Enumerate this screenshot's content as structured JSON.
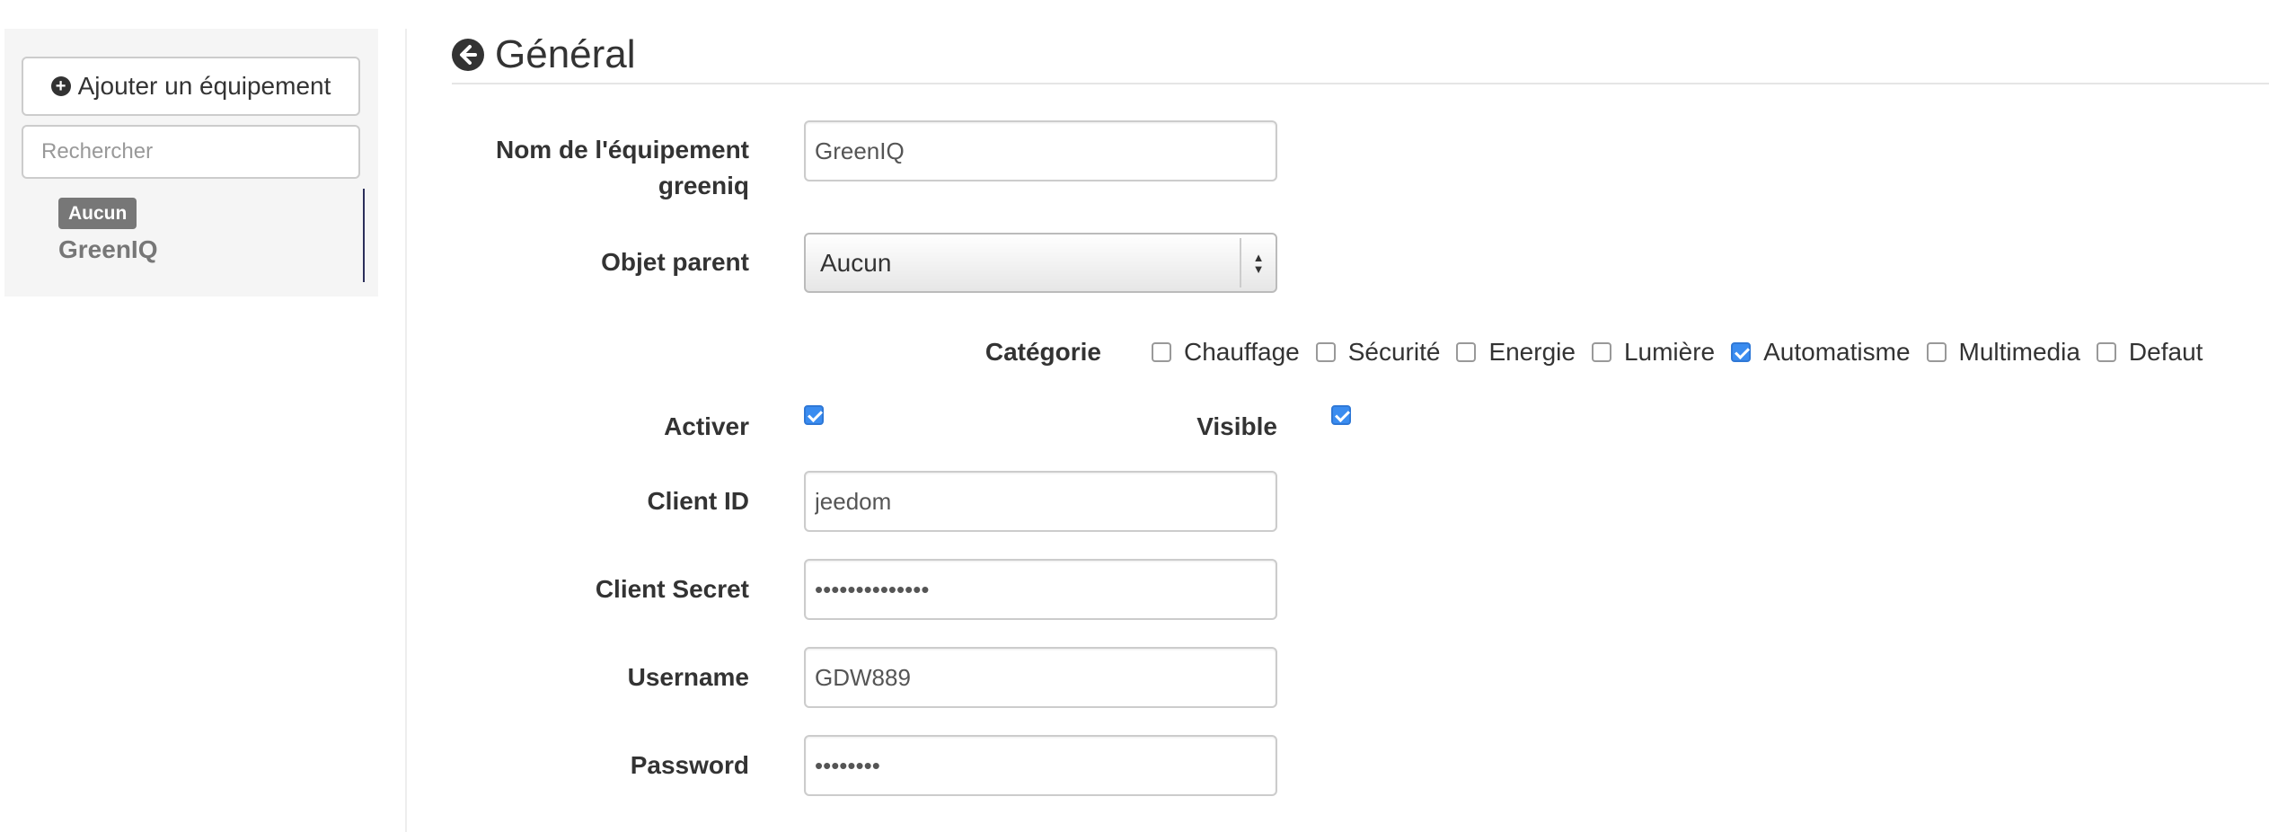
{
  "sidebar": {
    "add_button_label": "Ajouter un équipement",
    "search_placeholder": "Rechercher",
    "tree": {
      "group_badge": "Aucun",
      "item_name": "GreenIQ"
    }
  },
  "header": {
    "title": "Général"
  },
  "form": {
    "name_label_line1": "Nom de l'équipement",
    "name_label_line2": "greeniq",
    "name_value": "GreenIQ",
    "parent_label": "Objet parent",
    "parent_value": "Aucun",
    "category_label": "Catégorie",
    "categories": [
      {
        "label": "Chauffage",
        "checked": false
      },
      {
        "label": "Sécurité",
        "checked": false
      },
      {
        "label": "Energie",
        "checked": false
      },
      {
        "label": "Lumière",
        "checked": false
      },
      {
        "label": "Automatisme",
        "checked": true
      },
      {
        "label": "Multimedia",
        "checked": false
      },
      {
        "label": "Defaut",
        "checked": false
      }
    ],
    "activate_label": "Activer",
    "activate_checked": true,
    "visible_label": "Visible",
    "visible_checked": true,
    "client_id_label": "Client ID",
    "client_id_value": "jeedom",
    "client_secret_label": "Client Secret",
    "client_secret_value": "••••••••••••••",
    "username_label": "Username",
    "username_value": "GDW889",
    "password_label": "Password",
    "password_value": "••••••••"
  },
  "colors": {
    "checkbox_checked": "#3a8cf0",
    "badge_bg": "#777777",
    "tree_accent": "#2c2f5a"
  }
}
